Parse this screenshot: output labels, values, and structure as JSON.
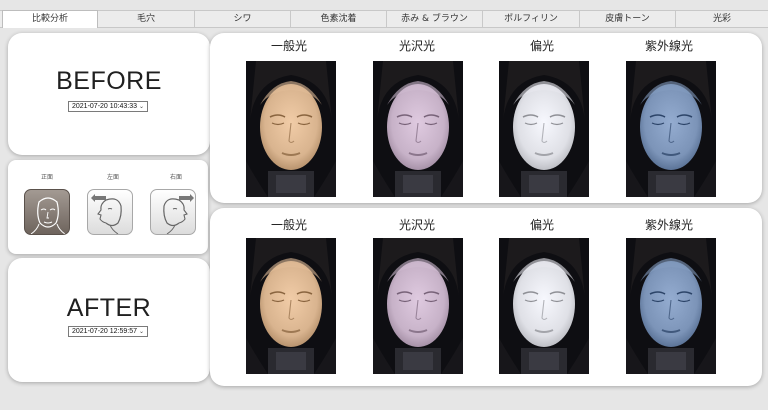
{
  "tabs": [
    {
      "label": "比較分析",
      "active": true
    },
    {
      "label": "毛穴",
      "active": false
    },
    {
      "label": "シワ",
      "active": false
    },
    {
      "label": "色素沈着",
      "active": false
    },
    {
      "label": "赤み & ブラウン",
      "active": false
    },
    {
      "label": "ポルフィリン",
      "active": false
    },
    {
      "label": "皮膚トーン",
      "active": false
    },
    {
      "label": "光彩",
      "active": false
    }
  ],
  "before": {
    "label": "BEFORE",
    "date": "2021-07-20 10:43:33"
  },
  "after": {
    "label": "AFTER",
    "date": "2021-07-20 12:59:57"
  },
  "angles": {
    "front": "正面",
    "left": "左面",
    "right": "右面",
    "selected": "front"
  },
  "lighting_modes": [
    "一般光",
    "光沢光",
    "偏光",
    "紫外線光"
  ],
  "colors": {
    "normal_skin": "#d9b48f",
    "gloss_skin": "#c7b2c8",
    "polarized_skin": "#dfe0e6",
    "uv_skin": "#7c94b8",
    "panel_bg": "#ffffff",
    "app_bg": "#e6e6e6",
    "active_angle": "#8a7f78"
  },
  "icons": {
    "select_caret": "chevron-down-icon",
    "front_face": "face-front-icon",
    "left_face": "face-left-icon",
    "right_face": "face-right-icon"
  }
}
